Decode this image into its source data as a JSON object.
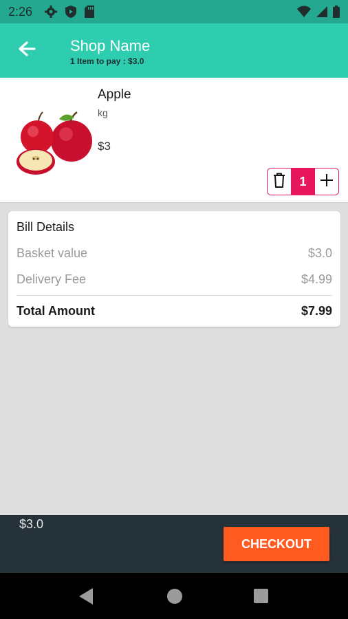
{
  "status_bar": {
    "time": "2:26",
    "left_icons": [
      "gear-icon",
      "shield-icon",
      "sd-card-icon"
    ],
    "right_icons": [
      "wifi-icon",
      "signal-icon",
      "battery-icon"
    ],
    "background": "#25a890"
  },
  "app_bar": {
    "title": "Shop Name",
    "subtitle": "1 Item to pay : $3.0",
    "back_icon": "arrow-left-icon",
    "background": "#2ecdb0"
  },
  "cart_item": {
    "name": "Apple",
    "unit": "kg",
    "price": "$3",
    "quantity": "1",
    "image": "apple-image",
    "delete_icon": "trash-icon",
    "add_icon": "plus-icon",
    "accent": "#e8175d"
  },
  "bill": {
    "title": "Bill Details",
    "rows": [
      {
        "label": "Basket value",
        "value": "$3.0"
      },
      {
        "label": "Delivery Fee",
        "value": "$4.99"
      }
    ],
    "total_label": "Total Amount",
    "total_value": "$7.99"
  },
  "bottom_bar": {
    "total": "$3.0",
    "checkout_label": "CHECKOUT",
    "checkout_color": "#ff5a1f"
  },
  "nav_bar": {
    "icons": [
      "back-triangle-icon",
      "home-circle-icon",
      "recents-square-icon"
    ]
  }
}
